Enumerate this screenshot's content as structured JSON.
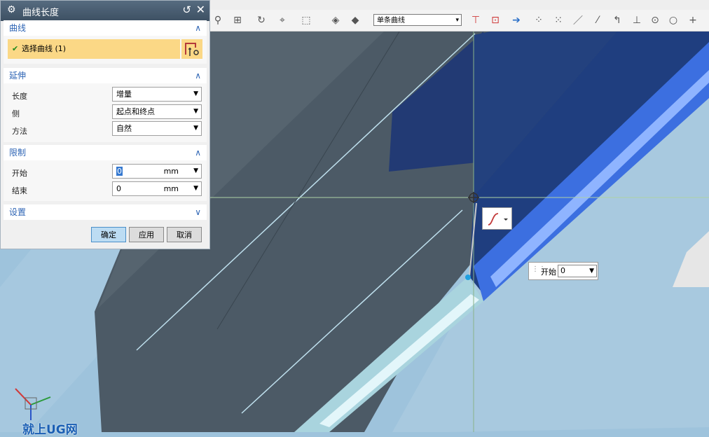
{
  "dialog": {
    "title": "曲线长度",
    "sections": {
      "curve": {
        "heading": "曲线",
        "select_label": "选择曲线 (1)"
      },
      "extend": {
        "heading": "延伸",
        "length_label": "长度",
        "length_value": "增量",
        "side_label": "侧",
        "side_value": "起点和终点",
        "method_label": "方法",
        "method_value": "自然"
      },
      "limits": {
        "heading": "限制",
        "start_label": "开始",
        "start_value": "0",
        "start_unit": "mm",
        "end_label": "结束",
        "end_value": "0",
        "end_unit": "mm"
      },
      "settings": {
        "heading": "设置"
      }
    },
    "buttons": {
      "ok": "确定",
      "apply": "应用",
      "cancel": "取消"
    }
  },
  "toolbar": {
    "curve_rule": "单条曲线"
  },
  "viewport": {
    "start_handle_label": "开始",
    "start_handle_value": "0",
    "watermark": "就上UG网"
  },
  "colors": {
    "accent": "#2d64b4",
    "selection": "#fbd886",
    "background": "#9ec3dc"
  },
  "icons": [
    "gear-icon",
    "reset-icon",
    "close-icon",
    "check-icon",
    "curve-select-icon",
    "chevron-up-icon",
    "chevron-down-icon",
    "s-curve-icon",
    "wcs-triad-icon"
  ]
}
